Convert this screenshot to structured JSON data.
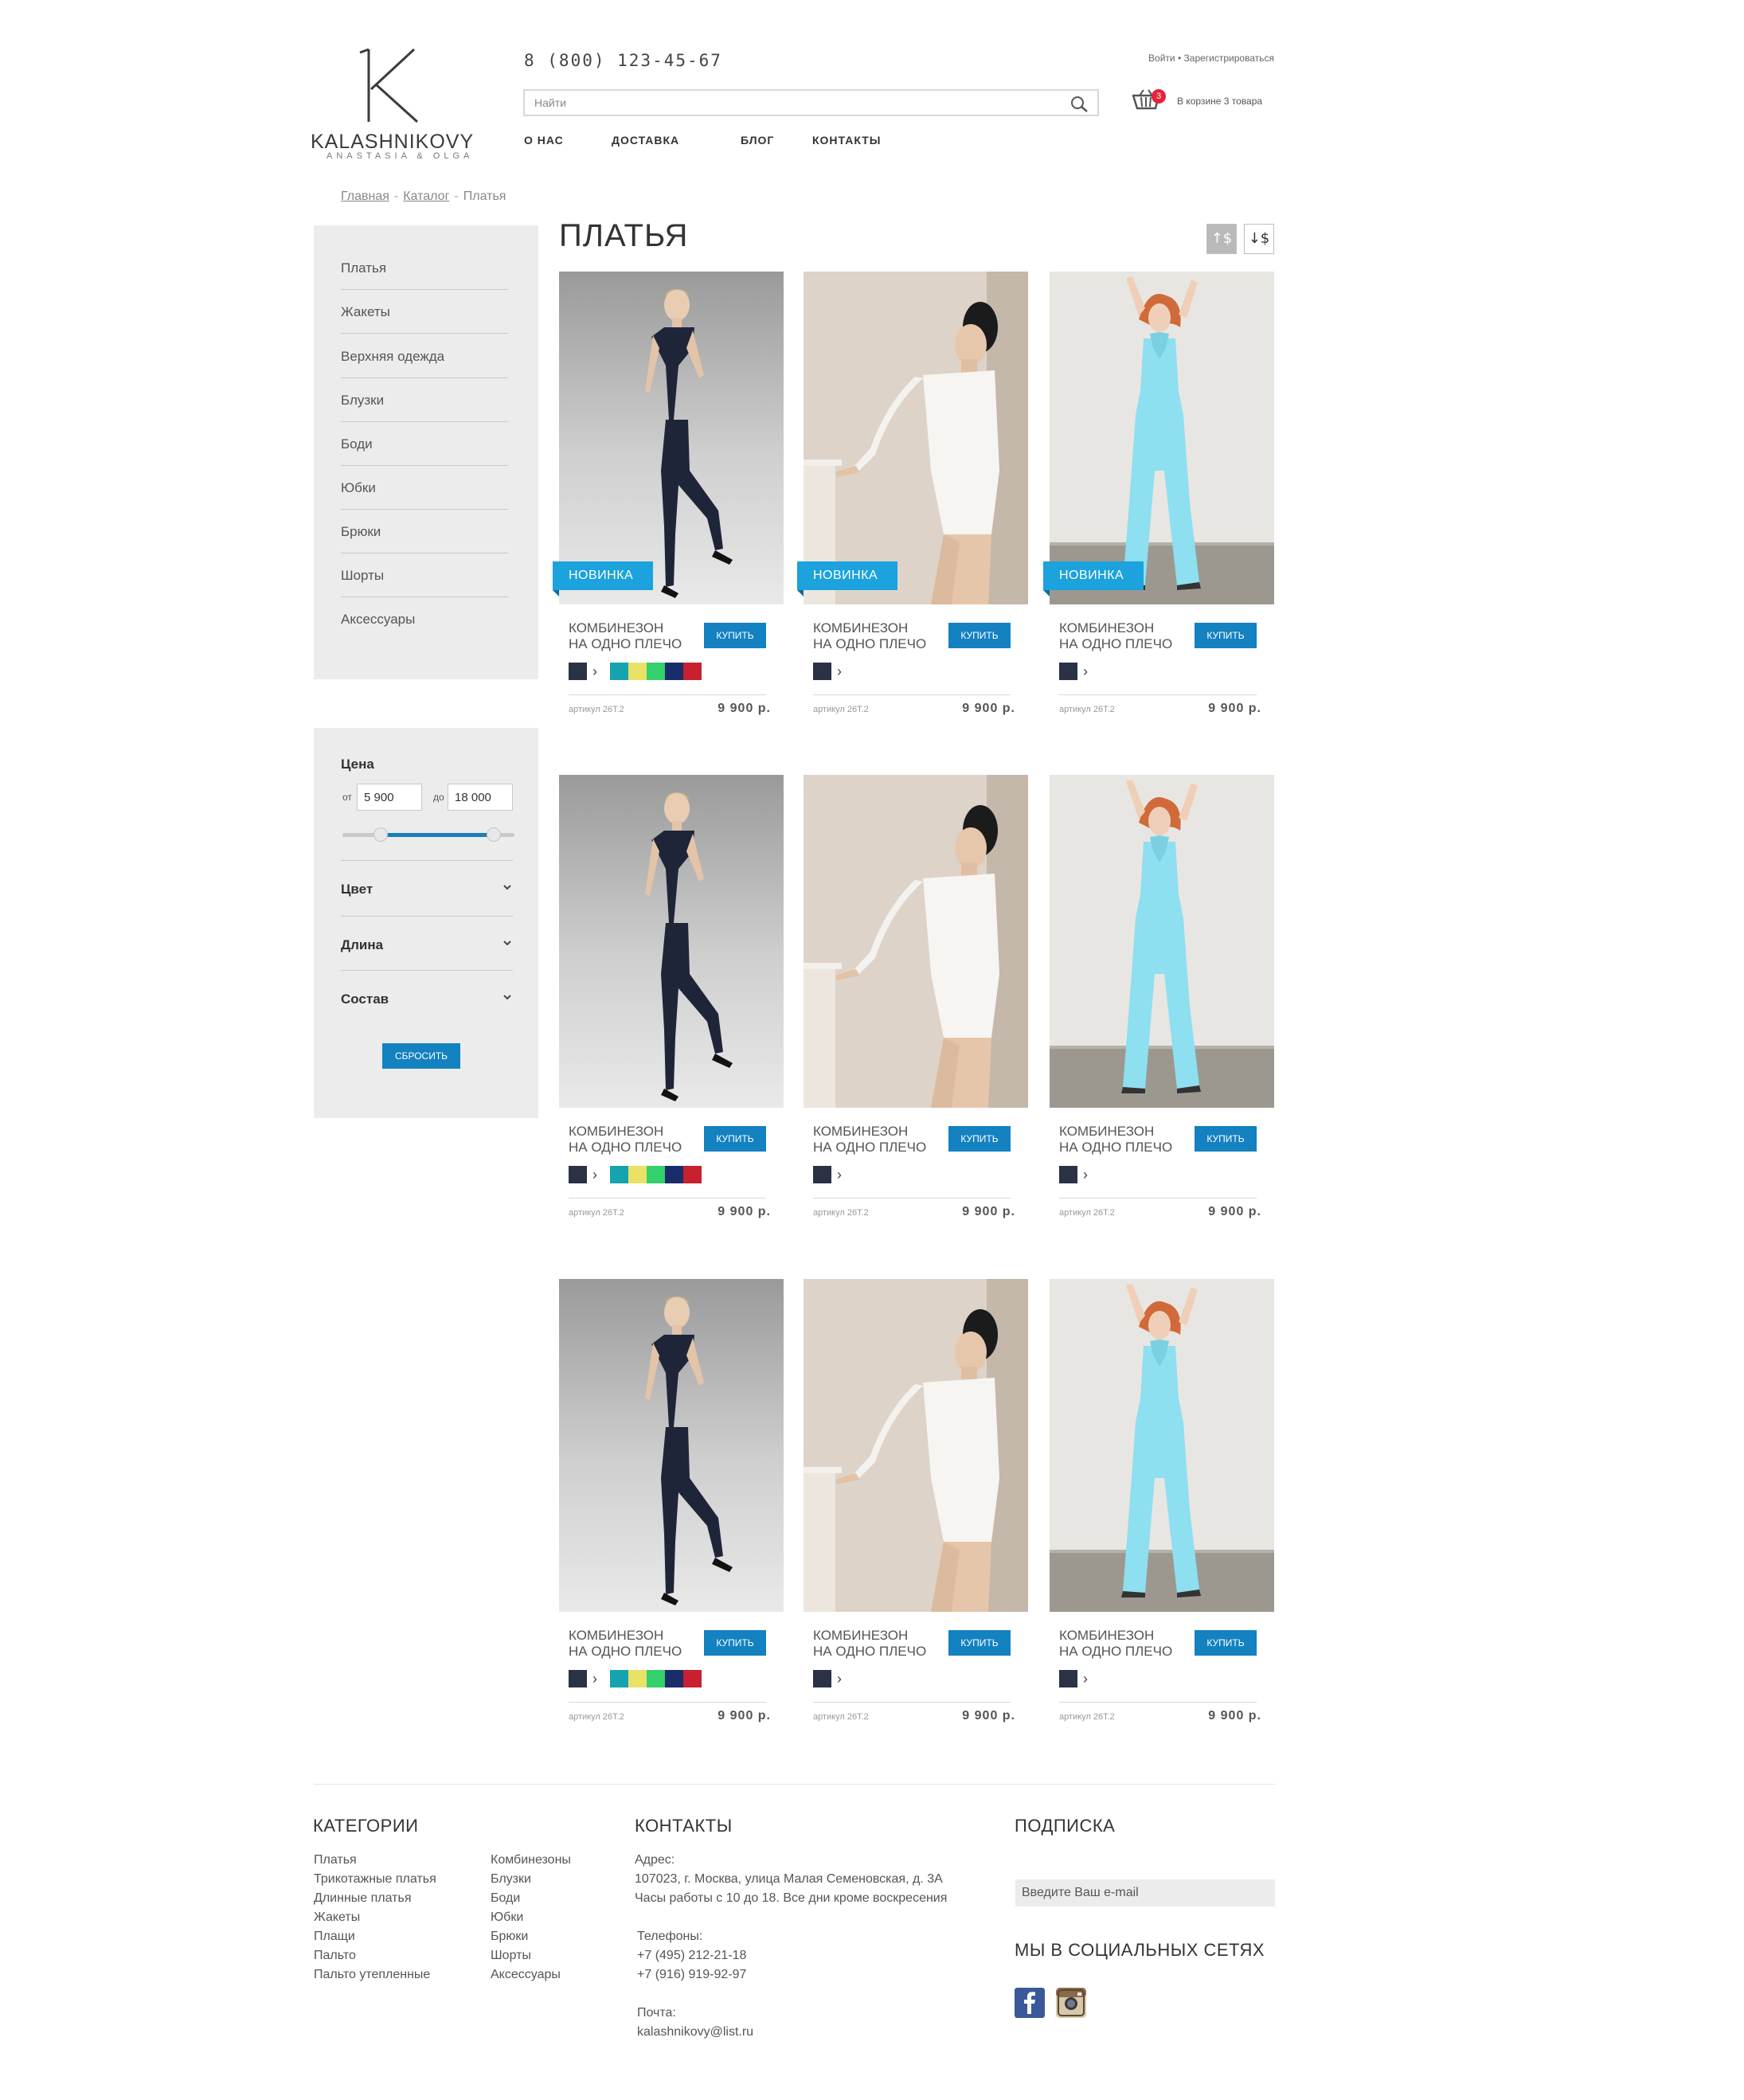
{
  "header": {
    "logo_letter": "K",
    "logo_name": "KALASHNIKOVY",
    "logo_sub": "ANASTASIA & OLGA",
    "phone": "8 (800) 123-45-67",
    "search_placeholder": "Найти",
    "nav": [
      "О НАС",
      "ДОСТАВКА",
      "БЛОГ",
      "КОНТАКТЫ"
    ],
    "login": "Войти",
    "auth_separator": "•",
    "register": "Зарегистрироваться",
    "cart_count": "3",
    "cart_text": "В корзине 3 товара"
  },
  "breadcrumb": {
    "home": "Главная",
    "catalog": "Каталог",
    "current": "Платья",
    "separator": "-"
  },
  "categories": [
    "Платья",
    "Жакеты",
    "Верхняя одежда",
    "Блузки",
    "Боди",
    "Юбки",
    "Брюки",
    "Шорты",
    "Аксессуары"
  ],
  "filter": {
    "price_title": "Цена",
    "from_label": "от",
    "from_value": "5 900",
    "to_label": "до",
    "to_value": "18 000",
    "range_low_fraction": 0.22,
    "range_high_fraction": 0.88,
    "groups": [
      "Цвет",
      "Длина",
      "Состав"
    ],
    "reset_label": "СБРОСИТЬ"
  },
  "main": {
    "title": "ПЛАТЬЯ",
    "sort_buttons": [
      "↑$",
      "↓$"
    ]
  },
  "products": [
    {
      "name_line1": "КОМБИНЕЗОН",
      "name_line2": "НА ОДНО ПЛЕЧО",
      "buy": "КУПИТЬ",
      "sku": "артикул 26Т.2",
      "price": "9 900 р.",
      "badge": "НОВИНКА",
      "model": "navy",
      "extra_colors": true
    },
    {
      "name_line1": "КОМБИНЕЗОН",
      "name_line2": "НА ОДНО ПЛЕЧО",
      "buy": "КУПИТЬ",
      "sku": "артикул 26Т.2",
      "price": "9 900 р.",
      "badge": "НОВИНКА",
      "model": "white",
      "extra_colors": false
    },
    {
      "name_line1": "КОМБИНЕЗОН",
      "name_line2": "НА ОДНО ПЛЕЧО",
      "buy": "КУПИТЬ",
      "sku": "артикул 26Т.2",
      "price": "9 900 р.",
      "badge": "НОВИНКА",
      "model": "blue",
      "extra_colors": false
    },
    {
      "name_line1": "КОМБИНЕЗОН",
      "name_line2": "НА ОДНО ПЛЕЧО",
      "buy": "КУПИТЬ",
      "sku": "артикул 26Т.2",
      "price": "9 900 р.",
      "badge": "",
      "model": "navy",
      "extra_colors": true
    },
    {
      "name_line1": "КОМБИНЕЗОН",
      "name_line2": "НА ОДНО ПЛЕЧО",
      "buy": "КУПИТЬ",
      "sku": "артикул 26Т.2",
      "price": "9 900 р.",
      "badge": "",
      "model": "white",
      "extra_colors": false
    },
    {
      "name_line1": "КОМБИНЕЗОН",
      "name_line2": "НА ОДНО ПЛЕЧО",
      "buy": "КУПИТЬ",
      "sku": "артикул 26Т.2",
      "price": "9 900 р.",
      "badge": "",
      "model": "blue",
      "extra_colors": false
    },
    {
      "name_line1": "КОМБИНЕЗОН",
      "name_line2": "НА ОДНО ПЛЕЧО",
      "buy": "КУПИТЬ",
      "sku": "артикул 26Т.2",
      "price": "9 900 р.",
      "badge": "",
      "model": "navy",
      "extra_colors": true
    },
    {
      "name_line1": "КОМБИНЕЗОН",
      "name_line2": "НА ОДНО ПЛЕЧО",
      "buy": "КУПИТЬ",
      "sku": "артикул 26Т.2",
      "price": "9 900 р.",
      "badge": "",
      "model": "white",
      "extra_colors": false
    },
    {
      "name_line1": "КОМБИНЕЗОН",
      "name_line2": "НА ОДНО ПЛЕЧО",
      "buy": "КУПИТЬ",
      "sku": "артикул 26Т.2",
      "price": "9 900 р.",
      "badge": "",
      "model": "blue",
      "extra_colors": false
    }
  ],
  "swatch_colors": {
    "selected": "#2b3246",
    "extra": [
      "#16a3b0",
      "#e9e267",
      "#34d06b",
      "#1b2c6b",
      "#c8202e"
    ]
  },
  "footer": {
    "categories_title": "КАТЕГОРИИ",
    "categories_col1": [
      "Платья",
      "Трикотажные платья",
      "Длинные платья",
      "Жакеты",
      "Плащи",
      "Пальто",
      "Пальто утепленные"
    ],
    "categories_col2": [
      "Комбинезоны",
      "Блузки",
      "Боди",
      "Юбки",
      "Брюки",
      "Шорты",
      "Аксессуары"
    ],
    "contacts_title": "КОНТАКТЫ",
    "address_label": "Адрес:",
    "address": "107023, г. Москва, улица Малая Семеновская, д. 3А",
    "hours": "Часы работы с 10 до 18. Все дни кроме воскресения",
    "phones_label": "Телефоны:",
    "phone1": "+7 (495) 212-21-18",
    "phone2": "+7 (916) 919-92-97",
    "mail_label": "Почта:",
    "mail": "kalashnikovy@list.ru",
    "subscribe_title": "ПОДПИСКА",
    "email_placeholder": "Введите Ваш e-mail",
    "social_title": "МЫ В СОЦИАЛЬНЫХ СЕТЯХ",
    "social_icons": [
      "facebook-icon",
      "instagram-icon"
    ],
    "facebook_color": "#3b5998"
  },
  "colors": {
    "accent": "#1481c0",
    "badge": "#1ca2dc",
    "panel": "#ececec",
    "cart_badge": "#e8223b"
  }
}
